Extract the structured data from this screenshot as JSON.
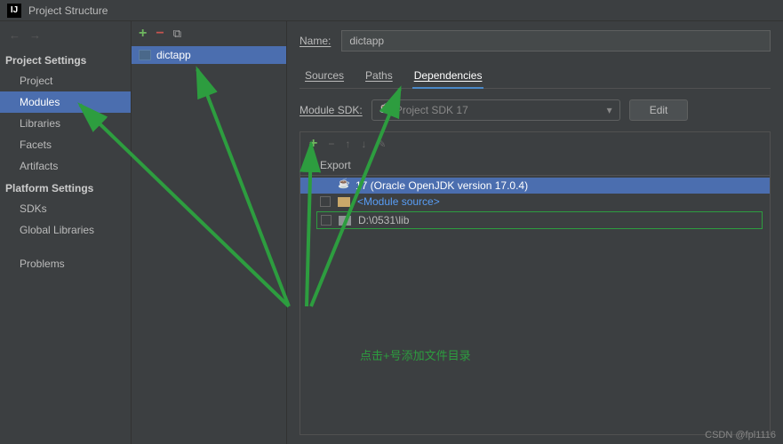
{
  "window_title": "Project Structure",
  "sidebar": {
    "section1": "Project Settings",
    "items1": [
      "Project",
      "Modules",
      "Libraries",
      "Facets",
      "Artifacts"
    ],
    "section2": "Platform Settings",
    "items2": [
      "SDKs",
      "Global Libraries"
    ],
    "section3_item": "Problems"
  },
  "module_list": {
    "selected": "dictapp"
  },
  "details": {
    "name_label": "Name:",
    "name_value": "dictapp",
    "tabs": [
      "Sources",
      "Paths",
      "Dependencies"
    ],
    "sdk_label": "Module SDK:",
    "sdk_value": "Project SDK 17",
    "edit_button": "Edit",
    "deps_header": "Export",
    "deps": {
      "sdk": "17 (Oracle OpenJDK version 17.0.4)",
      "module_source": "<Module source>",
      "lib_path": "D:\\0531\\lib"
    }
  },
  "annotation_text": "点击+号添加文件目录",
  "watermark": "CSDN @fpl1116"
}
